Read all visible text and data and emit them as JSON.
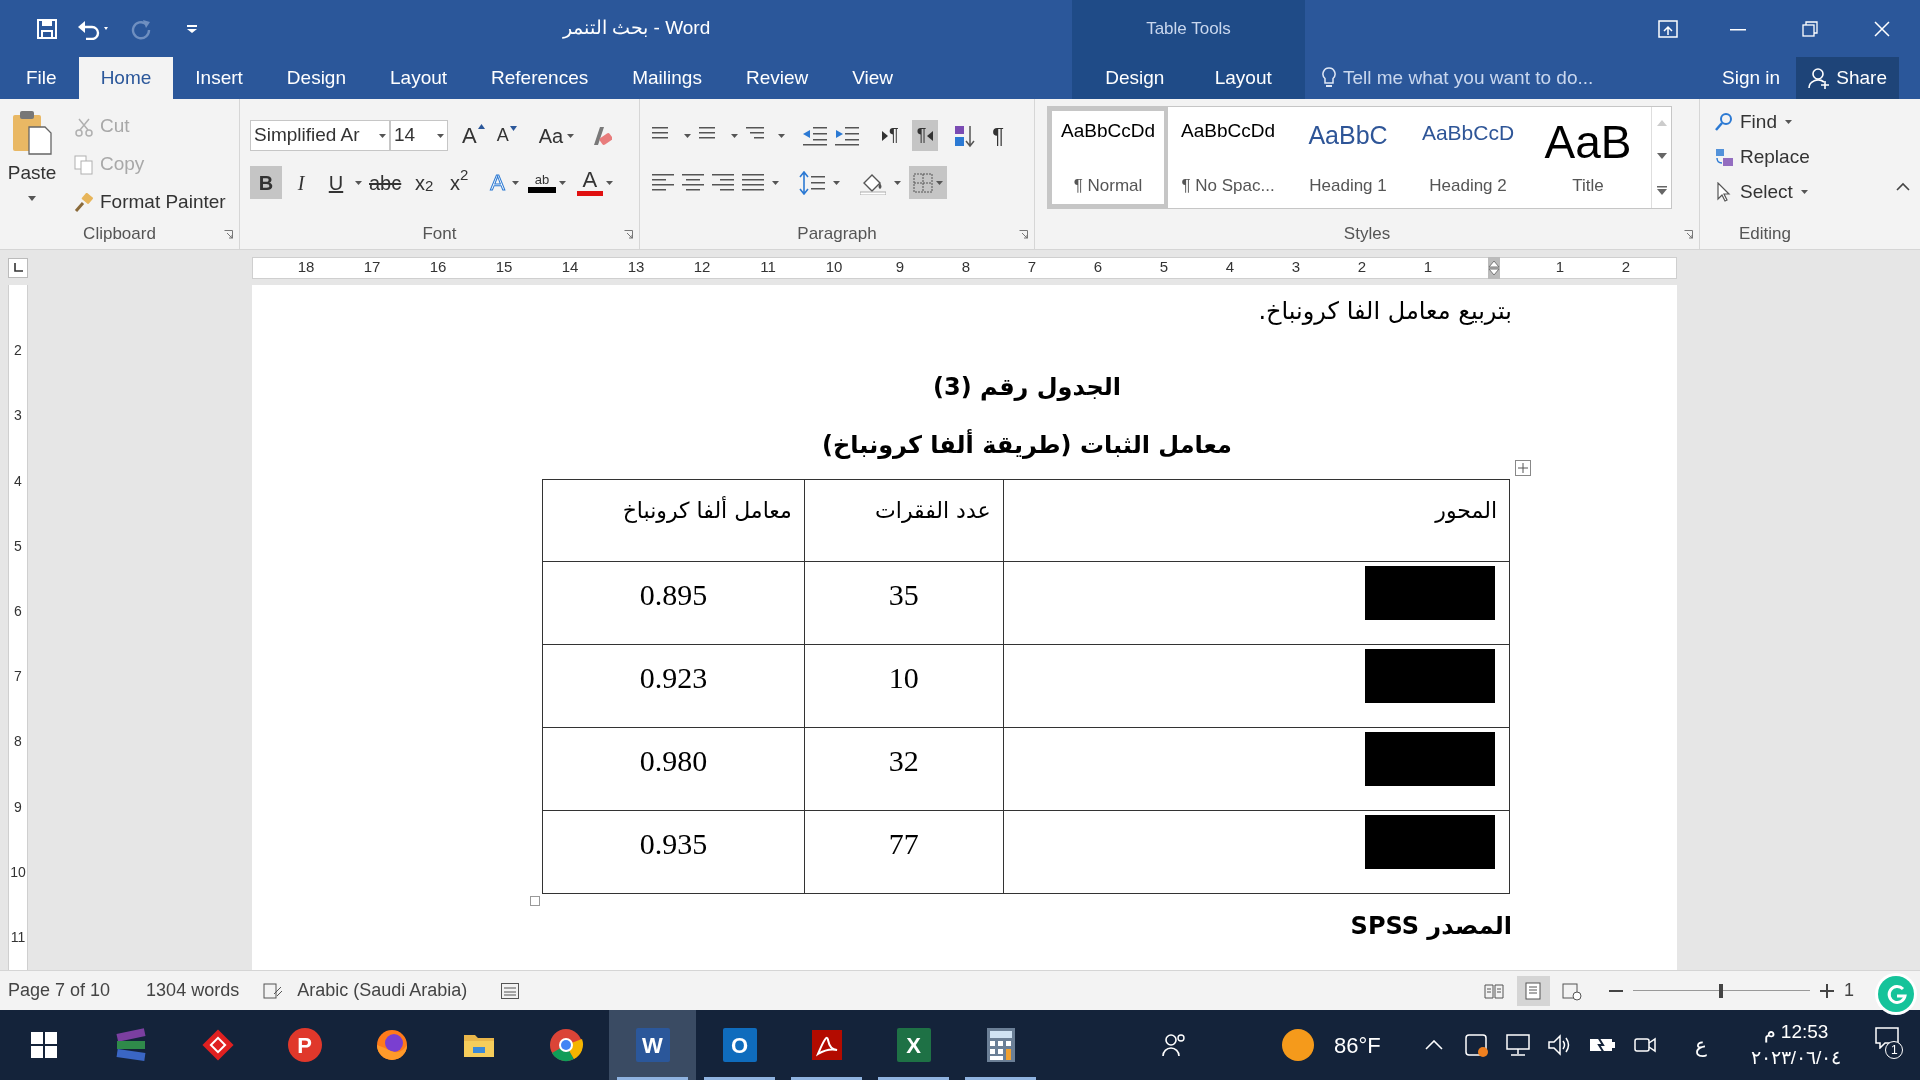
{
  "window": {
    "title": "بحث التنمر - Word",
    "context_title": "Table Tools"
  },
  "tabs": [
    {
      "label": "File",
      "selected": false,
      "kind": "main"
    },
    {
      "label": "Home",
      "selected": true,
      "kind": "main"
    },
    {
      "label": "Insert",
      "selected": false,
      "kind": "main"
    },
    {
      "label": "Design",
      "selected": false,
      "kind": "main"
    },
    {
      "label": "Layout",
      "selected": false,
      "kind": "main"
    },
    {
      "label": "References",
      "selected": false,
      "kind": "main"
    },
    {
      "label": "Mailings",
      "selected": false,
      "kind": "main"
    },
    {
      "label": "Review",
      "selected": false,
      "kind": "main"
    },
    {
      "label": "View",
      "selected": false,
      "kind": "main"
    },
    {
      "label": "Design",
      "selected": false,
      "kind": "contextual"
    },
    {
      "label": "Layout",
      "selected": false,
      "kind": "contextual"
    }
  ],
  "tell_me": {
    "placeholder": "Tell me what you want to do..."
  },
  "account": {
    "sign_in": "Sign in",
    "share": "Share"
  },
  "clipboard": {
    "group_label": "Clipboard",
    "paste": "Paste",
    "items": [
      {
        "label": "Cut",
        "kind": "cut",
        "disabled": true
      },
      {
        "label": "Copy",
        "kind": "copy",
        "disabled": true
      },
      {
        "label": "Format Painter",
        "kind": "painter",
        "disabled": false
      }
    ]
  },
  "font": {
    "group_label": "Font",
    "name": "Simplified Ar",
    "size": "14",
    "grow": "A",
    "shrink": "A",
    "case": "Aa",
    "effects": "A",
    "highlight": "ab",
    "color_label": "A",
    "format_buttons": [
      {
        "label": "B",
        "kind": "bold",
        "selected": true
      },
      {
        "label": "I",
        "kind": "italic",
        "selected": false
      },
      {
        "label": "U",
        "kind": "underline",
        "selected": false
      },
      {
        "label": "abc",
        "kind": "strike",
        "selected": false
      },
      {
        "label": "x$_{2}$",
        "kind": "sub",
        "selected": false
      },
      {
        "label": "x$^{2}$",
        "kind": "sup",
        "selected": false
      }
    ]
  },
  "paragraph": {
    "group_label": "Paragraph",
    "show_marks": "¶",
    "direction_buttons": [
      {
        "label": "¶",
        "kind": "ltr",
        "selected": false
      },
      {
        "label": "¶",
        "kind": "rtl",
        "selected": true
      }
    ],
    "borders_selected": true
  },
  "styles": {
    "group_label": "Styles",
    "items": [
      {
        "preview": "AaBbCcDd",
        "name": "¶ Normal",
        "kind": "normal",
        "selected": true
      },
      {
        "preview": "AaBbCcDd",
        "name": "¶ No Spac...",
        "kind": "nospace",
        "selected": false
      },
      {
        "preview": "AaBbC",
        "name": "Heading 1",
        "kind": "h1",
        "selected": false
      },
      {
        "preview": "AaBbCcD",
        "name": "Heading 2",
        "kind": "h2",
        "selected": false
      },
      {
        "preview": "AaB",
        "name": "Title",
        "kind": "title",
        "selected": false
      }
    ]
  },
  "editing": {
    "group_label": "Editing",
    "items": [
      {
        "label": "Find",
        "kind": "find"
      },
      {
        "label": "Replace",
        "kind": "replace"
      },
      {
        "label": "Select",
        "kind": "select"
      }
    ]
  },
  "ruler": {
    "left_labels": [
      "18",
      "17",
      "16",
      "15",
      "14",
      "13",
      "12",
      "11",
      "10",
      "9",
      "8",
      "7",
      "6",
      "5",
      "4",
      "3",
      "2",
      "1"
    ],
    "right_labels": [
      "1",
      "2"
    ]
  },
  "vertical_ruler": {
    "labels": [
      "2",
      "3",
      "4",
      "5",
      "6",
      "7",
      "8",
      "9",
      "10",
      "11"
    ]
  },
  "document": {
    "paragraph": "بتربيع معامل الفا كرونباخ.",
    "table_number": "الجدول رقم (3)",
    "table_title": "معامل الثبات (طريقة ألفا كرونباخ)",
    "table": {
      "columns": [
        "المحور",
        "عدد الفقرات",
        "معامل ألفا كرونباخ"
      ],
      "rows": [
        {
          "axis_redacted": true,
          "items": "35",
          "alpha": "0.895"
        },
        {
          "axis_redacted": true,
          "items": "10",
          "alpha": "0.923"
        },
        {
          "axis_redacted": true,
          "items": "32",
          "alpha": "0.980"
        },
        {
          "axis_redacted": true,
          "items": "77",
          "alpha": "0.935"
        }
      ]
    },
    "source": "المصدر SPSS"
  },
  "status_bar": {
    "page": "Page 7 of 10",
    "words": "1304 words",
    "language": "Arabic (Saudi Arabia)",
    "views": [
      {
        "kind": "read",
        "selected": false
      },
      {
        "kind": "print",
        "selected": true
      },
      {
        "kind": "web",
        "selected": false
      }
    ],
    "zoom": {
      "level": 0.5,
      "reading": "1"
    }
  },
  "taskbar": {
    "apps": [
      {
        "kind": "start",
        "running": false,
        "active": false
      },
      {
        "kind": "books",
        "running": false,
        "active": false
      },
      {
        "kind": "diamond",
        "running": false,
        "active": false
      },
      {
        "kind": "letter",
        "label": "P",
        "color": "#e0382b",
        "running": false,
        "active": false
      },
      {
        "kind": "firefox",
        "running": false,
        "active": false
      },
      {
        "kind": "folder",
        "running": false,
        "active": false
      },
      {
        "kind": "chrome",
        "running": false,
        "active": false
      },
      {
        "kind": "office",
        "label": "W",
        "color": "#2b579a",
        "running": true,
        "active": true
      },
      {
        "kind": "office",
        "label": "O",
        "color": "#0f6cbd",
        "running": true,
        "active": false
      },
      {
        "kind": "acrobat",
        "running": true,
        "active": false
      },
      {
        "kind": "office",
        "label": "X",
        "color": "#1e7145",
        "running": true,
        "active": false
      },
      {
        "kind": "calculator",
        "running": true,
        "active": false
      }
    ],
    "weather": "86°F",
    "language": "ع",
    "time": "12:53 م",
    "date": "٢٠٢٣/٠٦/٠٤",
    "notifications": "1"
  }
}
